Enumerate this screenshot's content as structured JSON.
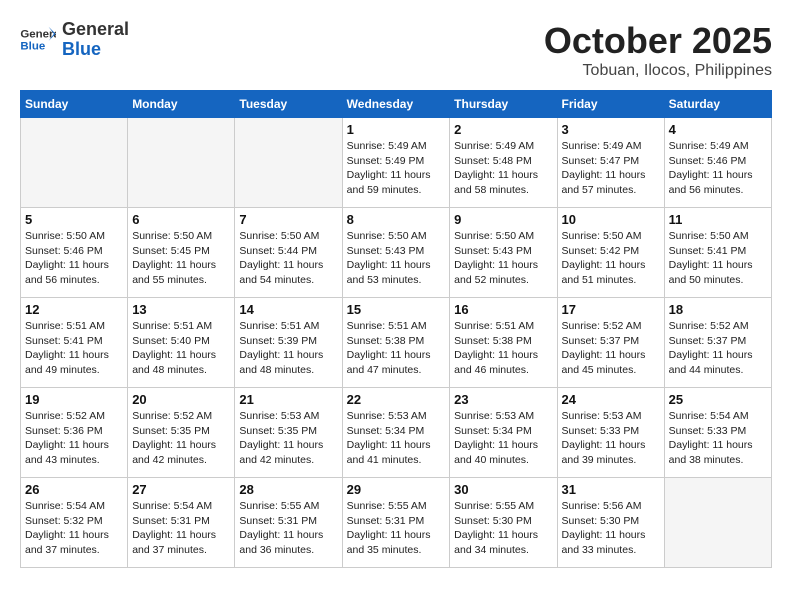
{
  "header": {
    "logo_general": "General",
    "logo_blue": "Blue",
    "month_title": "October 2025",
    "subtitle": "Tobuan, Ilocos, Philippines"
  },
  "calendar": {
    "days_of_week": [
      "Sunday",
      "Monday",
      "Tuesday",
      "Wednesday",
      "Thursday",
      "Friday",
      "Saturday"
    ],
    "weeks": [
      [
        {
          "day": "",
          "info": ""
        },
        {
          "day": "",
          "info": ""
        },
        {
          "day": "",
          "info": ""
        },
        {
          "day": "1",
          "info": "Sunrise: 5:49 AM\nSunset: 5:49 PM\nDaylight: 11 hours and 59 minutes."
        },
        {
          "day": "2",
          "info": "Sunrise: 5:49 AM\nSunset: 5:48 PM\nDaylight: 11 hours and 58 minutes."
        },
        {
          "day": "3",
          "info": "Sunrise: 5:49 AM\nSunset: 5:47 PM\nDaylight: 11 hours and 57 minutes."
        },
        {
          "day": "4",
          "info": "Sunrise: 5:49 AM\nSunset: 5:46 PM\nDaylight: 11 hours and 56 minutes."
        }
      ],
      [
        {
          "day": "5",
          "info": "Sunrise: 5:50 AM\nSunset: 5:46 PM\nDaylight: 11 hours and 56 minutes."
        },
        {
          "day": "6",
          "info": "Sunrise: 5:50 AM\nSunset: 5:45 PM\nDaylight: 11 hours and 55 minutes."
        },
        {
          "day": "7",
          "info": "Sunrise: 5:50 AM\nSunset: 5:44 PM\nDaylight: 11 hours and 54 minutes."
        },
        {
          "day": "8",
          "info": "Sunrise: 5:50 AM\nSunset: 5:43 PM\nDaylight: 11 hours and 53 minutes."
        },
        {
          "day": "9",
          "info": "Sunrise: 5:50 AM\nSunset: 5:43 PM\nDaylight: 11 hours and 52 minutes."
        },
        {
          "day": "10",
          "info": "Sunrise: 5:50 AM\nSunset: 5:42 PM\nDaylight: 11 hours and 51 minutes."
        },
        {
          "day": "11",
          "info": "Sunrise: 5:50 AM\nSunset: 5:41 PM\nDaylight: 11 hours and 50 minutes."
        }
      ],
      [
        {
          "day": "12",
          "info": "Sunrise: 5:51 AM\nSunset: 5:41 PM\nDaylight: 11 hours and 49 minutes."
        },
        {
          "day": "13",
          "info": "Sunrise: 5:51 AM\nSunset: 5:40 PM\nDaylight: 11 hours and 48 minutes."
        },
        {
          "day": "14",
          "info": "Sunrise: 5:51 AM\nSunset: 5:39 PM\nDaylight: 11 hours and 48 minutes."
        },
        {
          "day": "15",
          "info": "Sunrise: 5:51 AM\nSunset: 5:38 PM\nDaylight: 11 hours and 47 minutes."
        },
        {
          "day": "16",
          "info": "Sunrise: 5:51 AM\nSunset: 5:38 PM\nDaylight: 11 hours and 46 minutes."
        },
        {
          "day": "17",
          "info": "Sunrise: 5:52 AM\nSunset: 5:37 PM\nDaylight: 11 hours and 45 minutes."
        },
        {
          "day": "18",
          "info": "Sunrise: 5:52 AM\nSunset: 5:37 PM\nDaylight: 11 hours and 44 minutes."
        }
      ],
      [
        {
          "day": "19",
          "info": "Sunrise: 5:52 AM\nSunset: 5:36 PM\nDaylight: 11 hours and 43 minutes."
        },
        {
          "day": "20",
          "info": "Sunrise: 5:52 AM\nSunset: 5:35 PM\nDaylight: 11 hours and 42 minutes."
        },
        {
          "day": "21",
          "info": "Sunrise: 5:53 AM\nSunset: 5:35 PM\nDaylight: 11 hours and 42 minutes."
        },
        {
          "day": "22",
          "info": "Sunrise: 5:53 AM\nSunset: 5:34 PM\nDaylight: 11 hours and 41 minutes."
        },
        {
          "day": "23",
          "info": "Sunrise: 5:53 AM\nSunset: 5:34 PM\nDaylight: 11 hours and 40 minutes."
        },
        {
          "day": "24",
          "info": "Sunrise: 5:53 AM\nSunset: 5:33 PM\nDaylight: 11 hours and 39 minutes."
        },
        {
          "day": "25",
          "info": "Sunrise: 5:54 AM\nSunset: 5:33 PM\nDaylight: 11 hours and 38 minutes."
        }
      ],
      [
        {
          "day": "26",
          "info": "Sunrise: 5:54 AM\nSunset: 5:32 PM\nDaylight: 11 hours and 37 minutes."
        },
        {
          "day": "27",
          "info": "Sunrise: 5:54 AM\nSunset: 5:31 PM\nDaylight: 11 hours and 37 minutes."
        },
        {
          "day": "28",
          "info": "Sunrise: 5:55 AM\nSunset: 5:31 PM\nDaylight: 11 hours and 36 minutes."
        },
        {
          "day": "29",
          "info": "Sunrise: 5:55 AM\nSunset: 5:31 PM\nDaylight: 11 hours and 35 minutes."
        },
        {
          "day": "30",
          "info": "Sunrise: 5:55 AM\nSunset: 5:30 PM\nDaylight: 11 hours and 34 minutes."
        },
        {
          "day": "31",
          "info": "Sunrise: 5:56 AM\nSunset: 5:30 PM\nDaylight: 11 hours and 33 minutes."
        },
        {
          "day": "",
          "info": ""
        }
      ]
    ]
  }
}
